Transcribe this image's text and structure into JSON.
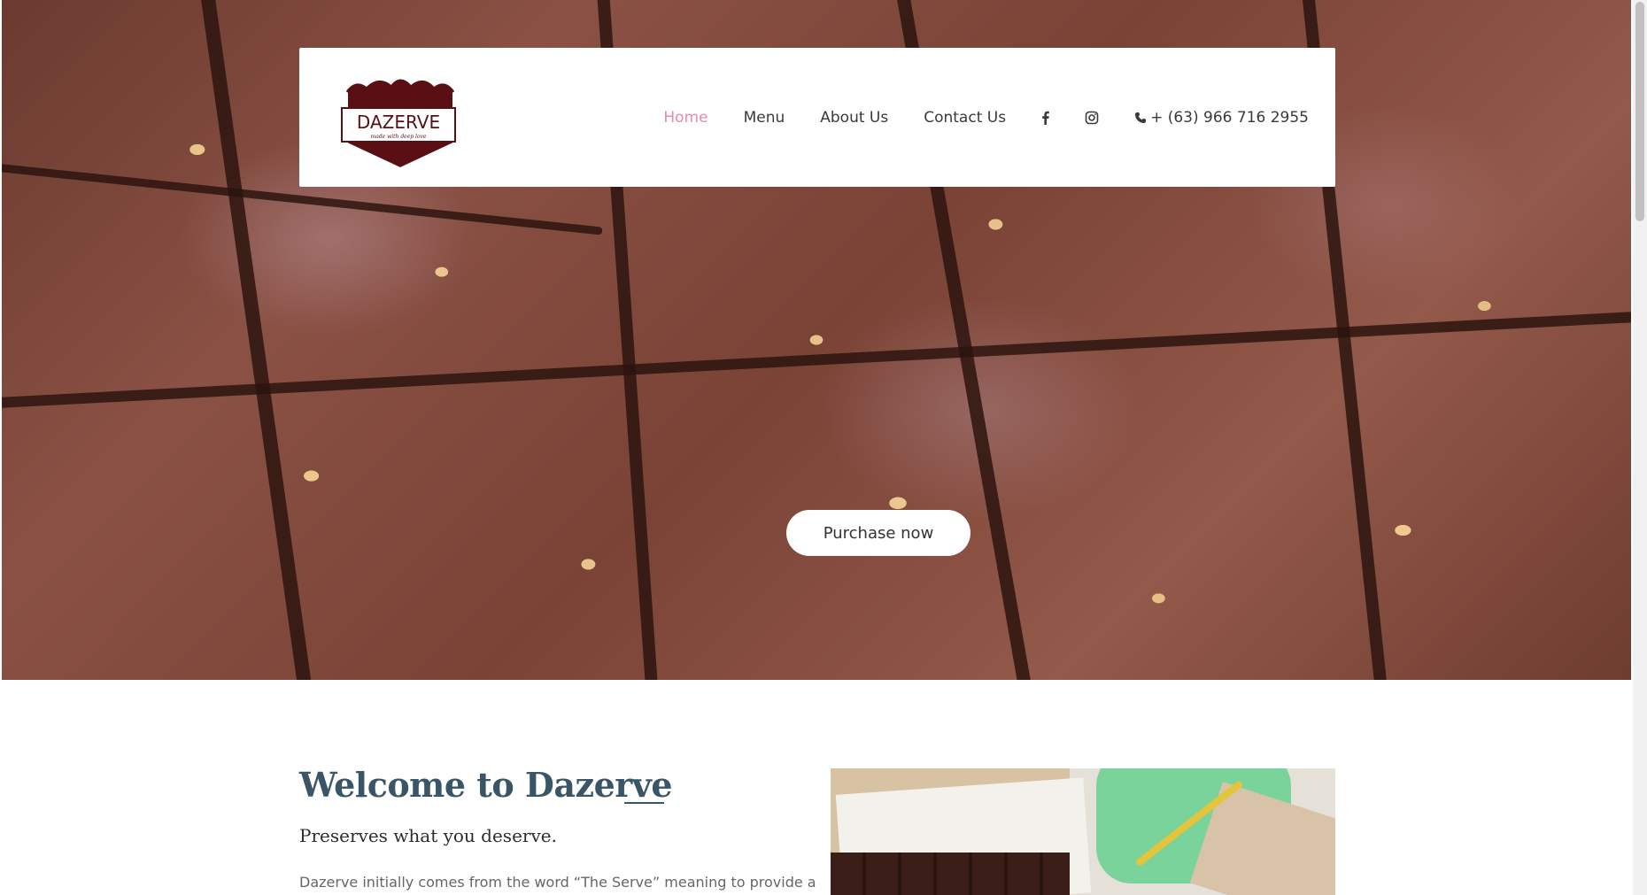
{
  "brand": {
    "logo_text": "DAZERVE",
    "logo_tagline": "made with deep love",
    "logo_colors": {
      "primary": "#5a0f14",
      "outline": "#ffffff"
    }
  },
  "nav": {
    "items": [
      {
        "label": "Home",
        "active": true
      },
      {
        "label": "Menu",
        "active": false
      },
      {
        "label": "About Us",
        "active": false
      },
      {
        "label": "Contact Us",
        "active": false
      }
    ],
    "social": [
      {
        "icon": "facebook-icon",
        "glyph": "f"
      },
      {
        "icon": "instagram-icon",
        "glyph": "◎"
      }
    ],
    "phone": {
      "icon": "phone-icon",
      "glyph": "✆",
      "text": "+ (63) 966 716 2955"
    },
    "active_color": "#e68aa6"
  },
  "hero": {
    "cta_label": "Purchase now"
  },
  "welcome": {
    "title": "Welcome to Dazerve",
    "subtitle": "Preserves what you deserve.",
    "body": "Dazerve initially comes from the word “The Serve” meaning to provide a"
  },
  "colors": {
    "title": "#3a5666",
    "body_text": "#666666"
  }
}
